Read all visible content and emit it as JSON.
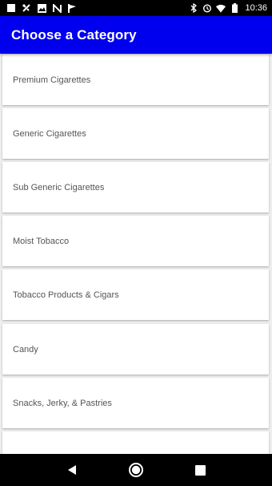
{
  "status_bar": {
    "time": "10:36",
    "left_icons": [
      "square-notification-icon",
      "settings-notification-icon",
      "image-notification-icon",
      "n-notification-icon",
      "flag-notification-icon"
    ],
    "right_icons": [
      "bluetooth-icon",
      "alarm-icon",
      "wifi-icon",
      "battery-icon"
    ]
  },
  "app_bar": {
    "title": "Choose a Category",
    "color": "#0000ee"
  },
  "categories": [
    {
      "label": "Premium Cigarettes"
    },
    {
      "label": "Generic Cigarettes"
    },
    {
      "label": "Sub Generic Cigarettes"
    },
    {
      "label": "Moist Tobacco"
    },
    {
      "label": "Tobacco Products & Cigars"
    },
    {
      "label": "Candy"
    },
    {
      "label": "Snacks, Jerky, & Pastries"
    },
    {
      "label": ""
    }
  ],
  "nav_bar": {
    "buttons": [
      "back-icon",
      "home-icon",
      "recents-icon"
    ]
  }
}
